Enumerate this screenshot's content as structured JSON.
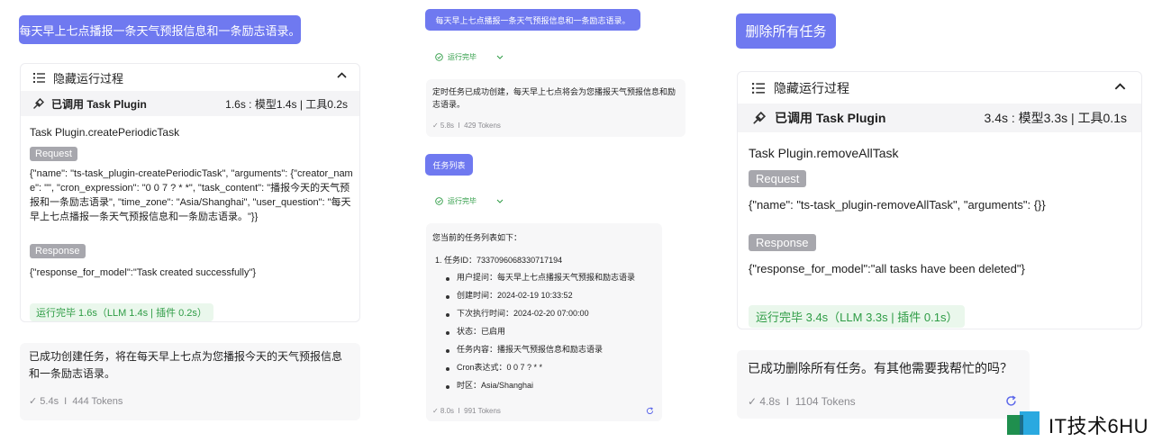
{
  "left": {
    "user_msg": "每天早上七点播报一条天气预报信息和一条励志语录。",
    "toggle_label": "隐藏运行过程",
    "plugin_called": "已调用 Task Plugin",
    "plugin_time": "1.6s : 模型1.4s | 工具0.2s",
    "func_name": "Task Plugin.createPeriodicTask",
    "request_tag": "Request",
    "request_body": "{\"name\": \"ts-task_plugin-createPeriodicTask\", \"arguments\": {\"creator_name\": \"\", \"cron_expression\": \"0 0 7 ? * *\", \"task_content\": \"播报今天的天气预报和一条励志语录\", \"time_zone\": \"Asia/Shanghai\", \"user_question\": \"每天早上七点播报一条天气预报信息和一条励志语录。\"}}",
    "response_tag": "Response",
    "response_body": "{\"response_for_model\":\"Task created successfully\"}",
    "done_status": "运行完毕 1.6s（LLM 1.4s | 插件 0.2s）",
    "answer": "已成功创建任务，将在每天早上七点为您播报今天的天气预报信息和一条励志语录。",
    "stats": "✓ 5.4s  I  444 Tokens"
  },
  "middle": {
    "user_msg_1": "每天早上七点播报一条天气预报信息和一条励志语录。",
    "status_1": "运行完毕",
    "answer_1": "定时任务已成功创建，每天早上七点将会为您播报天气预报信息和励志语录。",
    "stats_1": "✓ 5.8s  I  429 Tokens",
    "user_msg_2": "任务列表",
    "status_2": "运行完毕",
    "list_intro": "您当前的任务列表如下：",
    "task_id": "1. 任务ID：7337096068330717194",
    "items": [
      "用户提问：每天早上七点播报天气预报和励志语录",
      "创建时间：2024-02-19 10:33:52",
      "下次执行时间：2024-02-20 07:00:00",
      "状态：已启用",
      "任务内容：播报天气预报信息和励志语录",
      "Cron表达式：0 0 7 ? * *",
      "时区：Asia/Shanghai"
    ],
    "stats_2": "✓ 8.0s  I  991 Tokens"
  },
  "right": {
    "user_msg": "删除所有任务",
    "toggle_label": "隐藏运行过程",
    "plugin_called": "已调用 Task Plugin",
    "plugin_time": "3.4s : 模型3.3s | 工具0.1s",
    "func_name": "Task Plugin.removeAllTask",
    "request_tag": "Request",
    "request_body": "{\"name\": \"ts-task_plugin-removeAllTask\", \"arguments\": {}}",
    "response_tag": "Response",
    "response_body": "{\"response_for_model\":\"all tasks have been deleted\"}",
    "done_status": "运行完毕 3.4s（LLM 3.3s | 插件 0.1s）",
    "answer": "已成功删除所有任务。有其他需要我帮忙的吗？",
    "stats": "✓ 4.8s  I  1104 Tokens"
  },
  "watermark": {
    "text": "IT技术6HU",
    "colors": [
      "#1f8f4e",
      "#2aa9e0"
    ]
  }
}
